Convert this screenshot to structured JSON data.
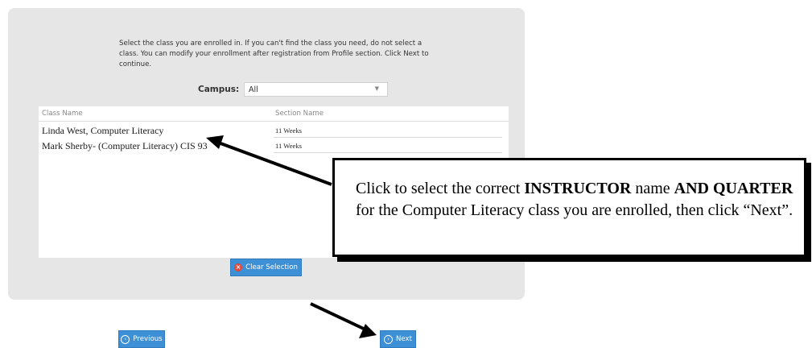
{
  "instructions": "Select the class you are enrolled in. If you can't find the class you need, do not select a class. You can modify your enrollment after registration from Profile section. Click Next to continue.",
  "campus": {
    "label": "Campus:",
    "selected": "All"
  },
  "table": {
    "headers": {
      "class_name": "Class Name",
      "section_name": "Section Name"
    },
    "rows": [
      {
        "class_name": "Linda West, Computer Literacy",
        "section": "11 Weeks"
      },
      {
        "class_name": "Mark Sherby- (Computer Literacy) CIS 93",
        "section": "11 Weeks"
      }
    ]
  },
  "clear_button": "Clear Selection",
  "callout": {
    "t1": "Click to select the correct ",
    "t2": "INSTRUCTOR",
    "t3": " name ",
    "t4": "AND QUARTER",
    "t5": " for the Computer Literacy class you are enrolled, then click “Next”."
  },
  "nav": {
    "previous": "Previous",
    "next": "Next"
  },
  "colors": {
    "button": "#3d8fd6",
    "panel": "#e6e6e6",
    "clear_icon": "#e5493a"
  }
}
